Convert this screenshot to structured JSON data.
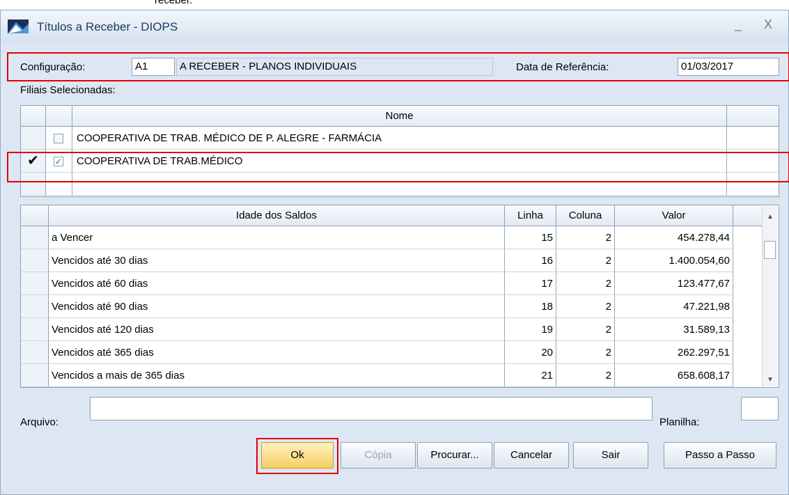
{
  "top_fragment": "receber.",
  "window": {
    "title": "Títulos a Receber - DIOPS",
    "minimize": "_",
    "close": "X"
  },
  "config": {
    "label": "Configuração:",
    "code": "A1",
    "description": "A RECEBER - PLANOS INDIVIDUAIS",
    "ref_label": "Data de Referência:",
    "ref_date": "01/03/2017"
  },
  "filiais": {
    "label": "Filiais Selecionadas:",
    "header": "Nome",
    "rows": [
      {
        "name": "COOPERATIVA DE TRAB. MÉDICO DE P. ALEGRE - FARMÁCIA",
        "checked": false,
        "current": false
      },
      {
        "name": "COOPERATIVA DE TRAB.MÉDICO",
        "checked": true,
        "current": true
      }
    ]
  },
  "saldos": {
    "headers": {
      "idade": "Idade dos Saldos",
      "linha": "Linha",
      "coluna": "Coluna",
      "valor": "Valor"
    },
    "rows": [
      {
        "idade": "a Vencer",
        "linha": "15",
        "coluna": "2",
        "valor": "454.278,44"
      },
      {
        "idade": "Vencidos até 30 dias",
        "linha": "16",
        "coluna": "2",
        "valor": "1.400.054,60"
      },
      {
        "idade": "Vencidos até 60 dias",
        "linha": "17",
        "coluna": "2",
        "valor": "123.477,67"
      },
      {
        "idade": "Vencidos até 90 dias",
        "linha": "18",
        "coluna": "2",
        "valor": "47.221,98"
      },
      {
        "idade": "Vencidos até 120 dias",
        "linha": "19",
        "coluna": "2",
        "valor": "31.589,13"
      },
      {
        "idade": "Vencidos até 365 dias",
        "linha": "20",
        "coluna": "2",
        "valor": "262.297,51"
      },
      {
        "idade": "Vencidos a mais de 365 dias",
        "linha": "21",
        "coluna": "2",
        "valor": "658.608,17"
      }
    ]
  },
  "arquivo": {
    "label": "Arquivo:",
    "value": ""
  },
  "planilha": {
    "label": "Planilha:",
    "value": ""
  },
  "buttons": {
    "ok": "Ok",
    "copia": "Cópia",
    "procurar": "Procurar...",
    "cancelar": "Cancelar",
    "sair": "Sair",
    "passo": "Passo a Passo"
  }
}
